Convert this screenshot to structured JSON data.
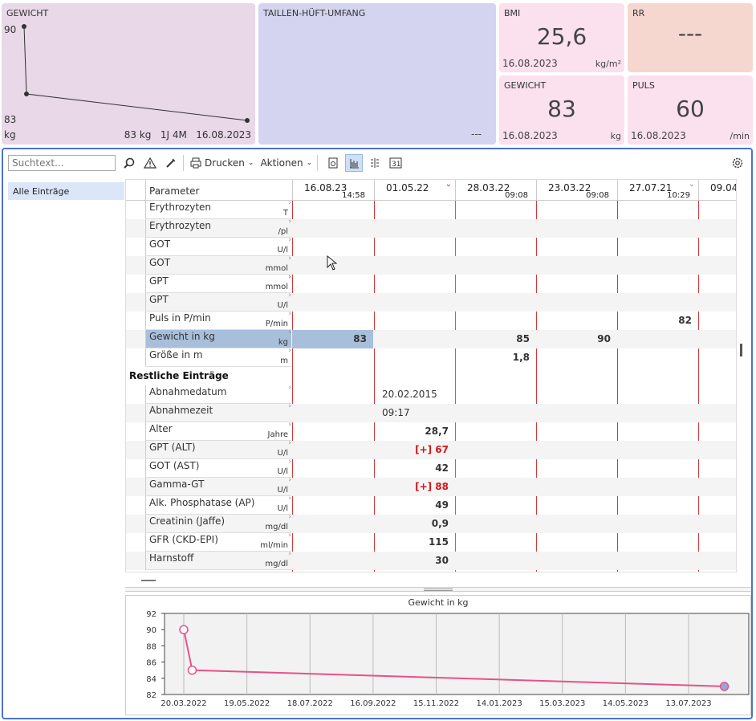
{
  "tiles": {
    "weight_chart": {
      "title": "GEWICHT",
      "ymax": "90",
      "ymin": "83",
      "unit": "kg",
      "summary": "83 kg",
      "span": "1J 4M",
      "date": "16.08.2023",
      "color": "#e8d8e8"
    },
    "waist": {
      "title": "TAILLEN-HÜFT-UMFANG",
      "value": "---",
      "color": "#d4d4f0"
    },
    "bmi": {
      "title": "BMI",
      "value": "25,6",
      "date": "16.08.2023",
      "unit": "kg/m²",
      "color": "#fbe0ee"
    },
    "rr": {
      "title": "RR",
      "value": "---",
      "color": "#f6d7cf"
    },
    "gewicht": {
      "title": "GEWICHT",
      "value": "83",
      "date": "16.08.2023",
      "unit": "kg",
      "color": "#fbe0ee"
    },
    "puls": {
      "title": "PULS",
      "value": "60",
      "date": "16.08.2023",
      "unit": "/min",
      "color": "#fbe0ee"
    }
  },
  "toolbar": {
    "search_placeholder": "Suchtext...",
    "print_label": "Drucken",
    "actions_label": "Aktionen"
  },
  "sidebar": {
    "all_entries": "Alle Einträge"
  },
  "grid": {
    "param_header": "Parameter",
    "columns": [
      {
        "date": "16.08.23",
        "time": "14:58"
      },
      {
        "date": "01.05.22",
        "time": ""
      },
      {
        "date": "28.03.22",
        "time": "09:08"
      },
      {
        "date": "23.03.22",
        "time": "09:08"
      },
      {
        "date": "27.07.21",
        "time": "10:29"
      },
      {
        "date": "09.04",
        "time": ""
      }
    ],
    "rows": [
      {
        "name": "Erythrozyten",
        "unit": "T",
        "values": [
          "",
          "",
          "",
          "",
          "",
          ""
        ]
      },
      {
        "name": "Erythrozyten",
        "unit": "/pl",
        "values": [
          "",
          "",
          "",
          "",
          "",
          ""
        ]
      },
      {
        "name": "GOT",
        "unit": "U/l",
        "values": [
          "",
          "",
          "",
          "",
          "",
          ""
        ]
      },
      {
        "name": "GOT",
        "unit": "mmol",
        "values": [
          "",
          "",
          "",
          "",
          "",
          ""
        ]
      },
      {
        "name": "GPT",
        "unit": "mmol",
        "values": [
          "",
          "",
          "",
          "",
          "",
          ""
        ]
      },
      {
        "name": "GPT",
        "unit": "U/l",
        "values": [
          "",
          "",
          "",
          "",
          "",
          ""
        ]
      },
      {
        "name": "Puls in P/min",
        "unit": "P/min",
        "values": [
          "",
          "",
          "",
          "",
          "82",
          ""
        ]
      },
      {
        "name": "Gewicht in kg",
        "unit": "kg",
        "values": [
          "83",
          "",
          "85",
          "90",
          "",
          ""
        ]
      },
      {
        "name": "Größe in m",
        "unit": "m",
        "values": [
          "",
          "",
          "1,8",
          "",
          "",
          ""
        ]
      }
    ],
    "section_label": "Restliche Einträge",
    "rest_rows": [
      {
        "name": "Abnahmedatum",
        "unit": "",
        "value": "20.02.2015"
      },
      {
        "name": "Abnahmezeit",
        "unit": "",
        "value": "09:17"
      },
      {
        "name": "Alter",
        "unit": "Jahre",
        "value": "28,7"
      },
      {
        "name": "GPT (ALT)",
        "unit": "U/l",
        "value": "[+] 67"
      },
      {
        "name": "GOT (AST)",
        "unit": "U/l",
        "value": "42"
      },
      {
        "name": "Gamma-GT",
        "unit": "U/l",
        "value": "[+] 88"
      },
      {
        "name": "Alk. Phosphatase (AP)",
        "unit": "U/l",
        "value": "49"
      },
      {
        "name": "Creatinin (Jaffe)",
        "unit": "mg/dl",
        "value": "0,9"
      },
      {
        "name": "GFR (CKD-EPI)",
        "unit": "ml/min",
        "value": "115"
      },
      {
        "name": "Harnstoff",
        "unit": "mg/dl",
        "value": "30"
      }
    ]
  },
  "chart_data": {
    "type": "line",
    "title": "Gewicht in kg",
    "x": [
      "20.03.2022",
      "28.03.2022",
      "16.08.2023"
    ],
    "values": [
      90,
      85,
      83
    ],
    "xticks": [
      "20.03.2022",
      "19.05.2022",
      "18.07.2022",
      "16.09.2022",
      "15.11.2022",
      "14.01.2023",
      "15.03.2023",
      "14.05.2023",
      "13.07.2023"
    ],
    "yticks": [
      "92",
      "90",
      "88",
      "86",
      "84",
      "82"
    ],
    "ylim": [
      82,
      92
    ],
    "color": "#e8508a"
  }
}
